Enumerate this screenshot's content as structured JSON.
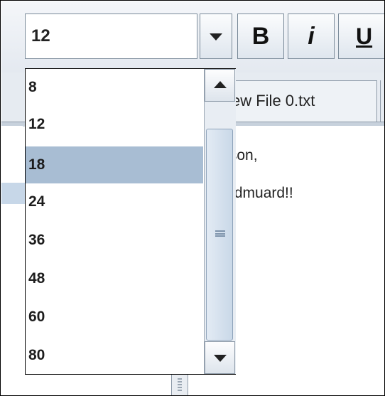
{
  "toolbar": {
    "font_size_value": "12",
    "bold_label": "B",
    "italic_label": "i",
    "underline_label": "U"
  },
  "tabs": [
    {
      "label": "ew File 0.txt"
    }
  ],
  "editor": {
    "lines": [
      "n jason,",
      "llo Edmuard!!"
    ]
  },
  "font_size_list": {
    "items": [
      "8",
      "12",
      "18",
      "24",
      "36",
      "48",
      "60",
      "80"
    ],
    "selected_index": 2
  },
  "icons": {
    "combo_arrow": "chevron-down-icon",
    "scroll_up": "scroll-up-arrow-icon",
    "scroll_down": "scroll-down-arrow-icon"
  },
  "colors": {
    "selection": "#a8bdd3",
    "toolbar_bg": "#e4e9f0"
  }
}
